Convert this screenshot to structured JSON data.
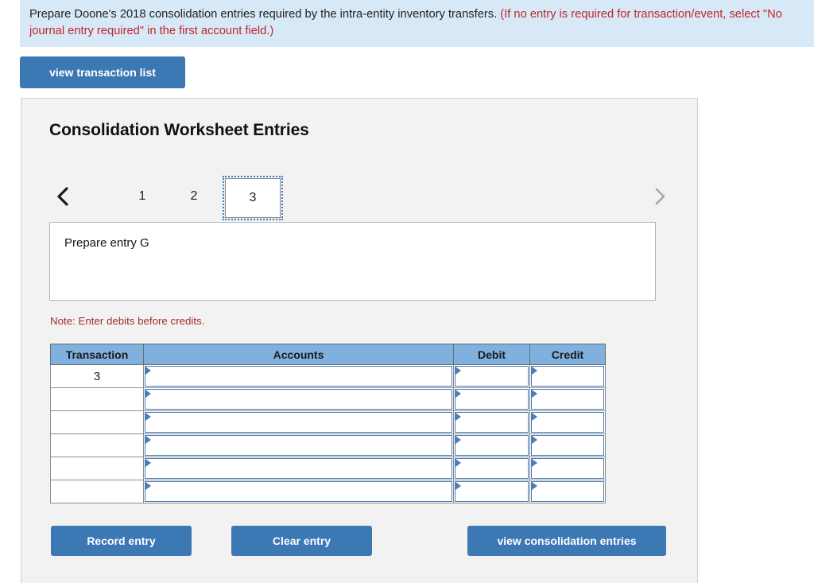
{
  "banner": {
    "text_plain": "Prepare Doone's 2018 consolidation entries required by the intra-entity inventory transfers. ",
    "text_red": "(If no entry is required for transaction/event, select \"No journal entry required\" in the first account field.)",
    "background_color": "#d7e9f7",
    "red_color": "#c0252c"
  },
  "toolbar": {
    "view_transaction_list_label": "view transaction list"
  },
  "card": {
    "title": "Consolidation Worksheet Entries",
    "background_color": "#f2f2f2",
    "accent_color": "#3c78b4"
  },
  "pager": {
    "prev_icon": "chevron-left-icon",
    "next_icon": "chevron-right-icon",
    "tabs": [
      {
        "label": "1",
        "selected": false
      },
      {
        "label": "2",
        "selected": false
      },
      {
        "label": "3",
        "selected": true
      }
    ],
    "selected_tab": "3"
  },
  "prompt": {
    "text": "Prepare entry G"
  },
  "note": {
    "text": "Note: Enter debits before credits.",
    "color": "#a42a2a"
  },
  "journal_table": {
    "header_color": "#7fb0de",
    "columns": [
      "Transaction",
      "Accounts",
      "Debit",
      "Credit"
    ],
    "rows": [
      {
        "transaction": "3",
        "account": "",
        "debit": "",
        "credit": ""
      },
      {
        "transaction": "",
        "account": "",
        "debit": "",
        "credit": ""
      },
      {
        "transaction": "",
        "account": "",
        "debit": "",
        "credit": ""
      },
      {
        "transaction": "",
        "account": "",
        "debit": "",
        "credit": ""
      },
      {
        "transaction": "",
        "account": "",
        "debit": "",
        "credit": ""
      },
      {
        "transaction": "",
        "account": "",
        "debit": "",
        "credit": ""
      }
    ]
  },
  "actions": {
    "record_entry_label": "Record entry",
    "clear_entry_label": "Clear entry",
    "view_consolidation_entries_label": "view consolidation entries"
  }
}
